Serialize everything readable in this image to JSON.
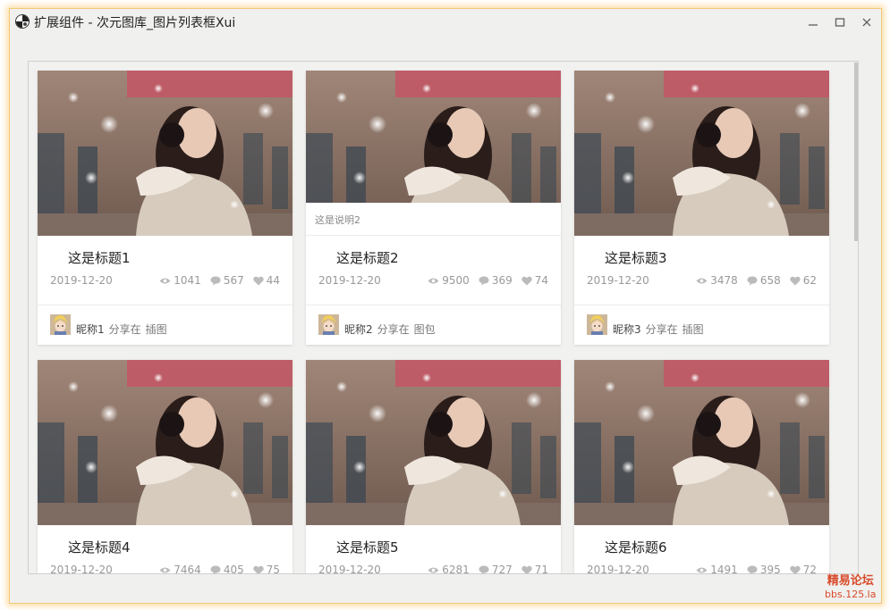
{
  "window": {
    "title": "扩展组件 - 次元图库_图片列表框Xui"
  },
  "cards": [
    {
      "title": "这是标题1",
      "date": "2019-12-20",
      "views": "1041",
      "comments": "567",
      "likes": "44",
      "nick": "昵称1",
      "action": "分享在",
      "category": "插图",
      "caption": ""
    },
    {
      "title": "这是标题2",
      "date": "2019-12-20",
      "views": "9500",
      "comments": "369",
      "likes": "74",
      "nick": "昵称2",
      "action": "分享在",
      "category": "图包",
      "caption": "这是说明2"
    },
    {
      "title": "这是标题3",
      "date": "2019-12-20",
      "views": "3478",
      "comments": "658",
      "likes": "62",
      "nick": "昵称3",
      "action": "分享在",
      "category": "插图",
      "caption": ""
    },
    {
      "title": "这是标题4",
      "date": "2019-12-20",
      "views": "7464",
      "comments": "405",
      "likes": "75"
    },
    {
      "title": "这是标题5",
      "date": "2019-12-20",
      "views": "6281",
      "comments": "727",
      "likes": "71"
    },
    {
      "title": "这是标题6",
      "date": "2019-12-20",
      "views": "1491",
      "comments": "395",
      "likes": "72"
    }
  ],
  "watermark": {
    "line1": "精易论坛",
    "line2": "bbs.125.la"
  },
  "colors": {
    "window_border": "#f3c878",
    "background": "#f0f0ee",
    "watermark": "#d84a2a"
  },
  "icons": {
    "views": "eye-icon",
    "comments": "comment-icon",
    "likes": "heart-icon"
  }
}
